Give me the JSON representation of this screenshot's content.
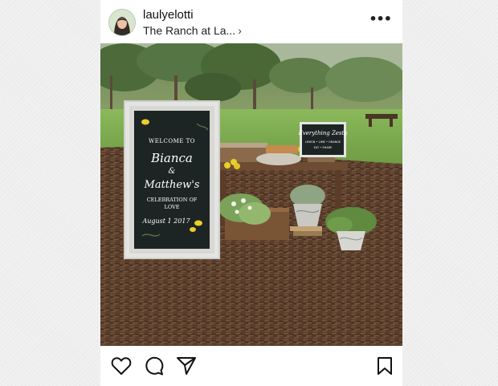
{
  "post": {
    "username": "laulyelotti",
    "location": "The Ranch at La...",
    "location_chevron": "›",
    "more_icon": "more-horizontal-icon",
    "more_glyph": "•••"
  },
  "photo": {
    "sign_large": {
      "line1": "WELCOME TO",
      "line2": "Bianca",
      "line3": "&",
      "line4": "Matthew's",
      "line5": "CELEBRATION OF",
      "line6": "LOVE",
      "line7": "August 1 2017"
    },
    "sign_small": {
      "line1": "Everything Zesty",
      "line2": "LEMON • LIME • ORANGE",
      "line3": "EAT • SHARE"
    }
  },
  "actions": {
    "like_icon": "heart-icon",
    "comment_icon": "comment-icon",
    "share_icon": "send-icon",
    "save_icon": "bookmark-icon"
  },
  "colors": {
    "chalkboard": "#1d2424",
    "frame": "#e4e4e2",
    "lemon": "#e8cf2a",
    "grass": "#7fae4c",
    "mulch": "#5c3f2b"
  }
}
